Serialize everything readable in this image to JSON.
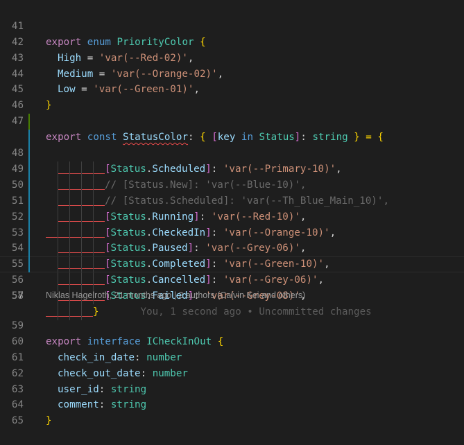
{
  "lines": {
    "l41": {
      "num": "41",
      "t1": "export",
      "t2": " enum ",
      "t3": "PriorityColor",
      "t4": " {"
    },
    "l42": {
      "num": "42",
      "k": "High",
      "eq": " = ",
      "v": "'var(--Red-02)'",
      "end": ","
    },
    "l43": {
      "num": "43",
      "k": "Medium",
      "eq": " = ",
      "v": "'var(--Orange-02)'",
      "end": ","
    },
    "l44": {
      "num": "44",
      "k": "Low",
      "eq": " = ",
      "v": "'var(--Green-01)'",
      "end": ","
    },
    "l45": {
      "num": "45",
      "close": "}"
    },
    "l46": {
      "num": "46"
    },
    "l47": {
      "num": "47",
      "t1": "export",
      "t2": " const ",
      "t3": "StatusColor",
      "t4": ": ",
      "t5": "{",
      "t6": " [",
      "t7": "key",
      "t8": " in ",
      "t9": "Status",
      "t10": "]",
      "t11": ": ",
      "t12": "string",
      "t13": " } = ",
      "t14": "{"
    },
    "l48": {
      "num": "48",
      "ob": "[",
      "obj": "Status",
      "dot": ".",
      "mem": "Scheduled",
      "cb": "]",
      "col": ": ",
      "v": "'var(--Primary-10)'",
      "end": ","
    },
    "l49": {
      "num": "49",
      "cm": "// [Status.New]: 'var(--Blue-10)',"
    },
    "l50": {
      "num": "50",
      "cm": "// [Status.Scheduled]: 'var(--Th_Blue_Main_10)',"
    },
    "l51": {
      "num": "51",
      "ob": "[",
      "obj": "Status",
      "dot": ".",
      "mem": "Running",
      "cb": "]",
      "col": ": ",
      "v": "'var(--Red-10)'",
      "end": ","
    },
    "l52": {
      "num": "52",
      "ob": "[",
      "obj": "Status",
      "dot": ".",
      "mem": "CheckedIn",
      "cb": "]",
      "col": ": ",
      "v": "'var(--Orange-10)'",
      "end": ","
    },
    "l53": {
      "num": "53",
      "ob": "[",
      "obj": "Status",
      "dot": ".",
      "mem": "Paused",
      "cb": "]",
      "col": ": ",
      "v": "'var(--Grey-06)'",
      "end": ","
    },
    "l54": {
      "num": "54",
      "ob": "[",
      "obj": "Status",
      "dot": ".",
      "mem": "Completed",
      "cb": "]",
      "col": ": ",
      "v": "'var(--Green-10)'",
      "end": ","
    },
    "l55": {
      "num": "55",
      "ob": "[",
      "obj": "Status",
      "dot": ".",
      "mem": "Cancelled",
      "cb": "]",
      "col": ": ",
      "v": "'var(--Grey-06)'",
      "end": ","
    },
    "l56": {
      "num": "56",
      "ob": "[",
      "obj": "Status",
      "dot": ".",
      "mem": "Failed",
      "cb": "]",
      "col": ": ",
      "v": "'var(--Grey-08)'",
      "end": ","
    },
    "l57": {
      "num": "57",
      "close": "}",
      "blame": "You, 1 second ago • Uncommitted changes"
    },
    "l58": {
      "num": "58"
    },
    "lens": "Niklas Hagelroth, 21 months ago | 2 authors (Calvin Kei and others)",
    "l59": {
      "num": "59",
      "t1": "export",
      "t2": " interface ",
      "t3": "ICheckInOut",
      "t4": " {"
    },
    "l60": {
      "num": "60",
      "k": "check_in_date",
      "col": ": ",
      "ty": "number"
    },
    "l61": {
      "num": "61",
      "k": "check_out_date",
      "col": ": ",
      "ty": "number"
    },
    "l62": {
      "num": "62",
      "k": "user_id",
      "col": ": ",
      "ty": "string"
    },
    "l63": {
      "num": "63",
      "k": "comment",
      "col": ": ",
      "ty": "string"
    },
    "l64": {
      "num": "64",
      "close": "}"
    },
    "l65": {
      "num": "65"
    }
  },
  "colors": {
    "background": "#1e1e1e",
    "keyword": "#569cd6",
    "type": "#4ec9b0",
    "property": "#9cdcfe",
    "string": "#ce9178",
    "error_squiggle": "#f14c4c",
    "git_added": "#487e02",
    "git_modified": "#1b81a8"
  }
}
